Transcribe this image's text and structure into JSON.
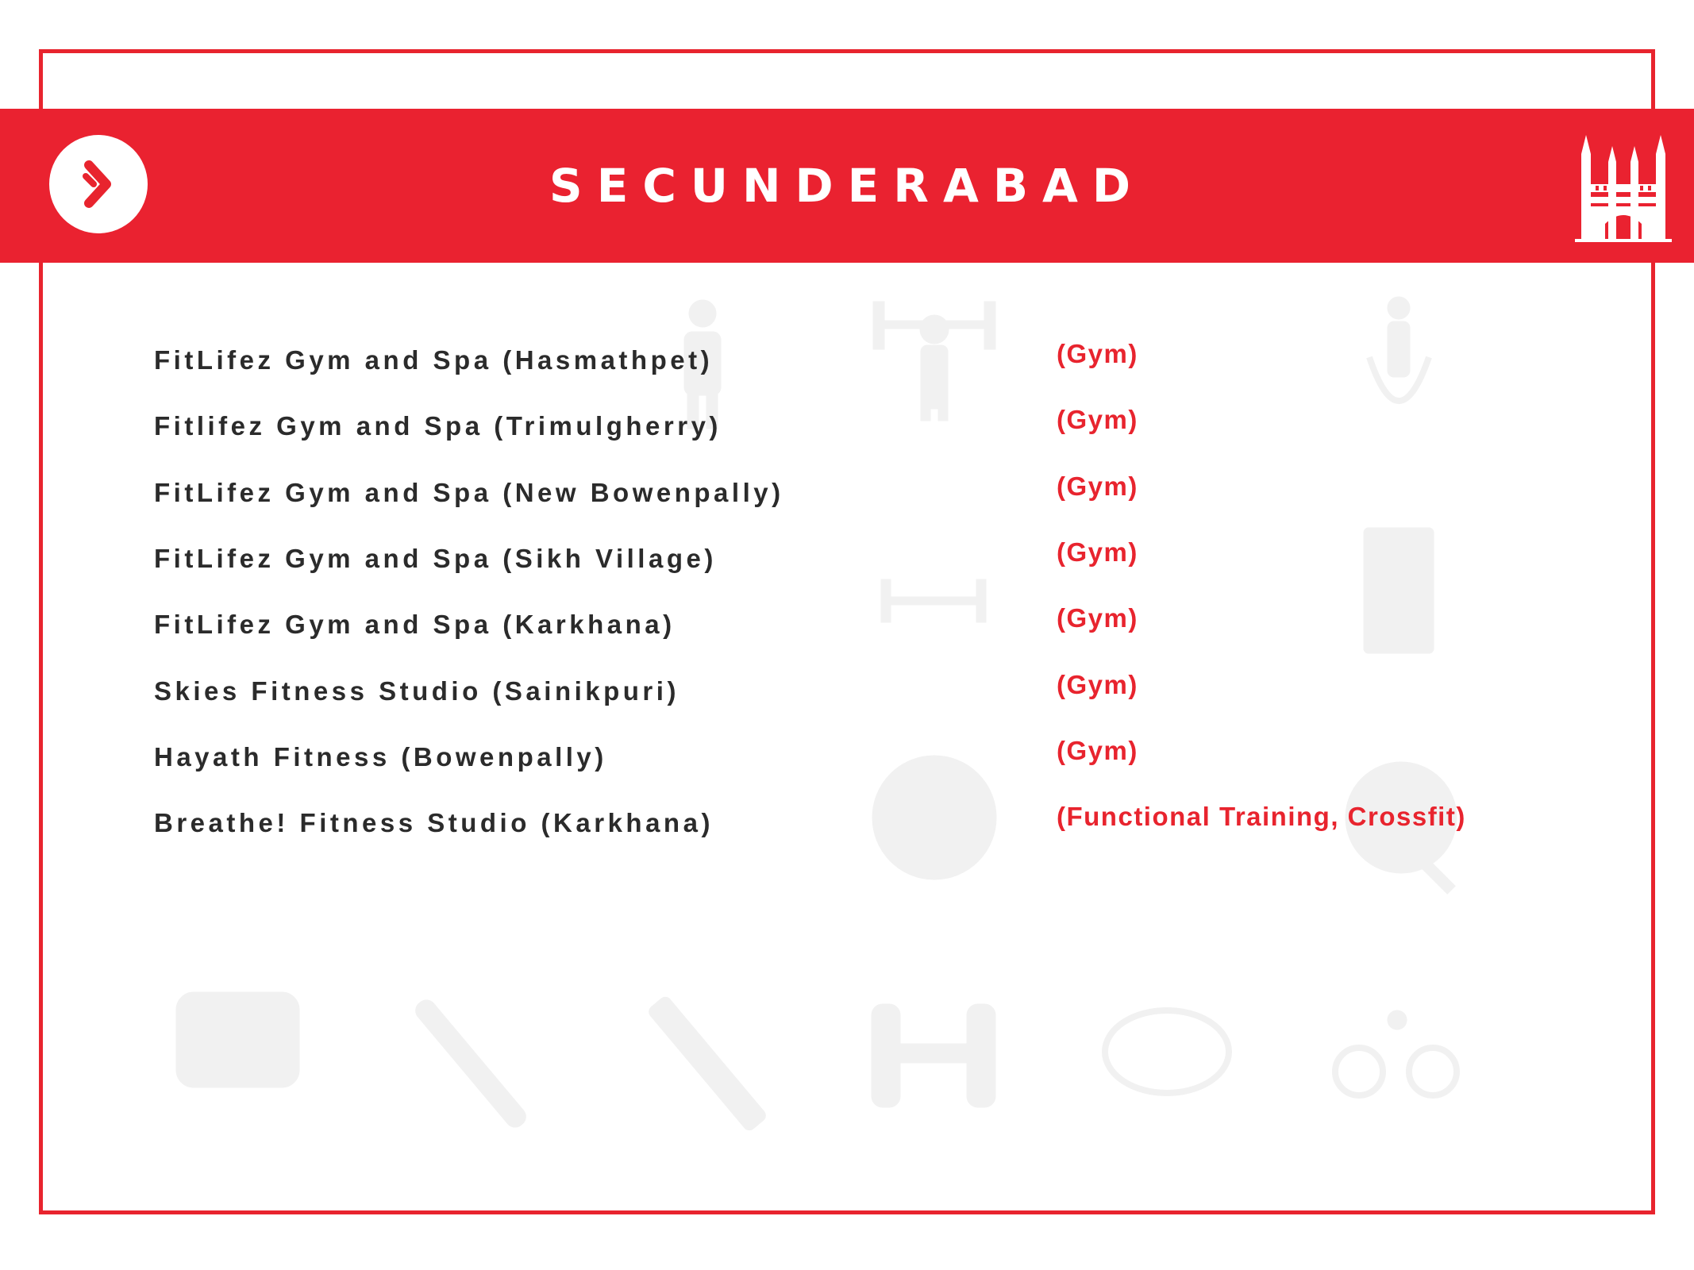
{
  "header": {
    "title": "SECUNDERABAD",
    "logo_icon": "chevron-right-icon",
    "monument_icon": "charminar-icon",
    "accent_color": "#e8242e"
  },
  "listings": [
    {
      "name": "FitLifez Gym and Spa (Hasmathpet)",
      "category": "(Gym)"
    },
    {
      "name": "Fitlifez Gym and Spa (Trimulgherry)",
      "category": "(Gym)"
    },
    {
      "name": "FitLifez Gym and Spa (New Bowenpally)",
      "category": "(Gym)"
    },
    {
      "name": "FitLifez Gym and Spa (Sikh Village)",
      "category": "(Gym)"
    },
    {
      "name": "FitLifez Gym and Spa (Karkhana)",
      "category": "(Gym)"
    },
    {
      "name": "Skies Fitness Studio (Sainikpuri)",
      "category": "(Gym)"
    },
    {
      "name": "Hayath Fitness (Bowenpally)",
      "category": "(Gym)"
    },
    {
      "name": "Breathe! Fitness Studio (Karkhana)",
      "category": "(Functional Training, Crossfit)"
    }
  ]
}
